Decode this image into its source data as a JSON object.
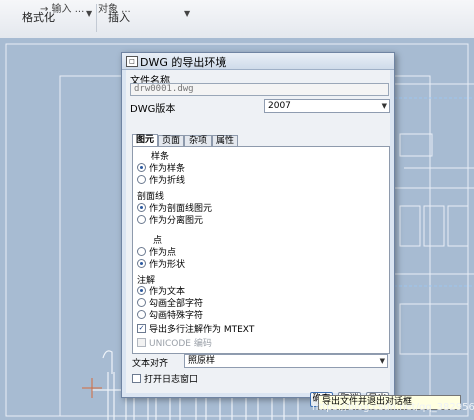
{
  "ribbon": {
    "cut_left": "→ 输入 ...",
    "cut_right": "对象 ...",
    "group_format": "格式化",
    "group_insert": "插入"
  },
  "dialog": {
    "title": "DWG 的导出环境",
    "file_name_label": "文件名称",
    "file_name_value": "drw0001.dwg",
    "version_label": "DWG版本",
    "version_value": "2007",
    "tabs": [
      "图元",
      "页面",
      "杂项",
      "属性"
    ],
    "spline_header": "样条",
    "spline_opt1": "作为样条",
    "spline_opt2": "作为折线",
    "section_header": "剖面线",
    "section_opt1": "作为剖面线图元",
    "section_opt2": "作为分离图元",
    "point_header": "点",
    "point_opt1": "作为点",
    "point_opt2": "作为形状",
    "note_header": "注解",
    "note_opt1": "作为文本",
    "note_opt2": "勾画全部字符",
    "note_opt3": "勾画特殊字符",
    "mtext_check": "导出多行注解作为 MTEXT",
    "unicode_check": "UNICODE 编码",
    "align_label": "文本对齐",
    "align_value": "照原样",
    "open_log": "打开日志窗口",
    "ok": "确定",
    "cancel": "取消",
    "export": "导出"
  },
  "tooltip": "导出文件并退出对话框",
  "watermark": "https://blog.csdn.net/qq_38295600"
}
